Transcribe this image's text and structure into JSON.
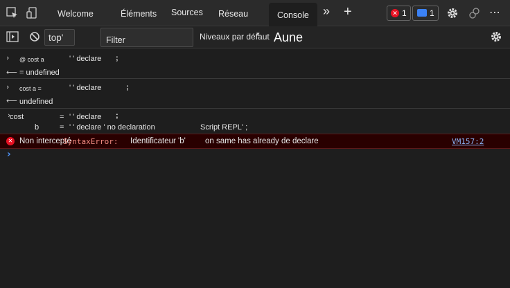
{
  "tabs": {
    "welcome": "Welcome",
    "elements": "Éléments",
    "sources": "Sources",
    "network": "Réseau",
    "console": "Console",
    "more": "»",
    "add": "+"
  },
  "badges": {
    "errors_count": "1",
    "messages_count": "1"
  },
  "toolbar": {
    "context_value": "top'",
    "filter_placeholder": "Filter",
    "levels_label": "Niveaux par défaut",
    "aune_label": "Aune"
  },
  "console": {
    "entry1": {
      "input_a": "@ cost a",
      "input_b": "' ' declare",
      "input_c": ";",
      "result": "= undefined"
    },
    "entry2": {
      "input_a": "cost a =",
      "input_b": "' ' declare",
      "input_c": ";",
      "result": "undefined"
    },
    "entry3": {
      "line1_a": "cost",
      "line1_b": "=",
      "line1_c": "' ' declare",
      "line1_d": ";",
      "line2_a": "b",
      "line2_b": "=",
      "line2_c": "' ' declare ' no declaration",
      "line2_d": "Script REPL' ;"
    },
    "error": {
      "prefix": "Non intercepté",
      "type": "SyntaxError:",
      "message_a": "Identificateur 'b'",
      "message_b": "on same has already de declare",
      "link": "VM157:2"
    },
    "prompt": "›"
  },
  "colors": {
    "error_bg": "#290000",
    "error_icon": "#e81123",
    "syntax_error": "#f28b82",
    "link": "#8ab4f8",
    "info_badge": "#3b82f6"
  }
}
